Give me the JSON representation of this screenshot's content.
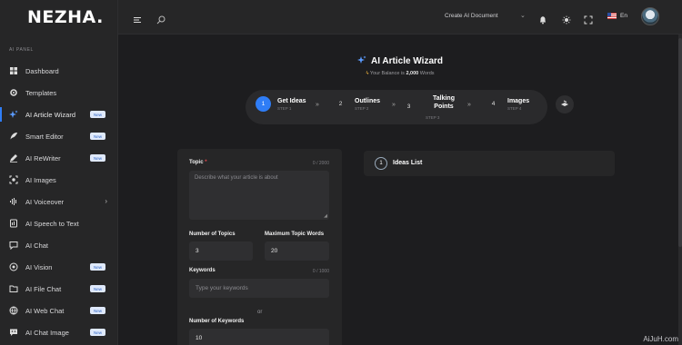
{
  "brand": {
    "logo": "NEZHA."
  },
  "sidebar": {
    "panel_label": "AI PANEL",
    "items": [
      {
        "label": "Dashboard",
        "icon": "grid-icon"
      },
      {
        "label": "Templates",
        "icon": "gear-icon"
      },
      {
        "label": "AI Article Wizard",
        "icon": "sparkles-icon",
        "badge": "New",
        "active": true
      },
      {
        "label": "Smart Editor",
        "icon": "feather-icon",
        "badge": "New"
      },
      {
        "label": "AI ReWriter",
        "icon": "pen-icon",
        "badge": "New"
      },
      {
        "label": "AI Images",
        "icon": "image-scan-icon"
      },
      {
        "label": "AI Voiceover",
        "icon": "waveform-icon",
        "chevron": true
      },
      {
        "label": "AI Speech to Text",
        "icon": "speech-doc-icon"
      },
      {
        "label": "AI Chat",
        "icon": "chat-icon"
      },
      {
        "label": "AI Vision",
        "icon": "eye-icon",
        "badge": "New"
      },
      {
        "label": "AI File Chat",
        "icon": "file-chat-icon",
        "badge": "New"
      },
      {
        "label": "AI Web Chat",
        "icon": "globe-icon",
        "badge": "New"
      },
      {
        "label": "AI Chat Image",
        "icon": "chat-image-icon",
        "badge": "New"
      }
    ]
  },
  "topbar": {
    "create_document": "Create AI Document",
    "language": "En"
  },
  "wizard": {
    "title": "AI Article Wizard",
    "balance_prefix": "Your Balance is ",
    "balance_value": "2,000",
    "balance_suffix": " Words",
    "steps": [
      {
        "num": "1",
        "title": "Get Ideas",
        "sub": "STEP 1"
      },
      {
        "num": "2",
        "title": "Outlines",
        "sub": "STEP 2"
      },
      {
        "num": "3",
        "title": "Talking Points",
        "sub": "STEP 3"
      },
      {
        "num": "4",
        "title": "Images",
        "sub": "STEP 4"
      }
    ],
    "arrow": "»"
  },
  "form": {
    "topic_label": "Topic",
    "topic_required": "*",
    "topic_count": "0 / 2000",
    "topic_placeholder": "Describe what your article is about",
    "num_topics_label": "Number of Topics",
    "num_topics_value": "3",
    "max_words_label": "Maximum Topic Words",
    "max_words_value": "20",
    "keywords_label": "Keywords",
    "keywords_count": "0 / 1000",
    "keywords_placeholder": "Type your keywords",
    "or_text": "or",
    "num_keywords_label": "Number of Keywords",
    "num_keywords_value": "10"
  },
  "ideas": {
    "num": "1",
    "title": "Ideas List"
  },
  "watermark": "AiJuH.com",
  "colors": {
    "accent": "#2f7df6",
    "background": "#1d1d1f",
    "panel": "#262627"
  }
}
